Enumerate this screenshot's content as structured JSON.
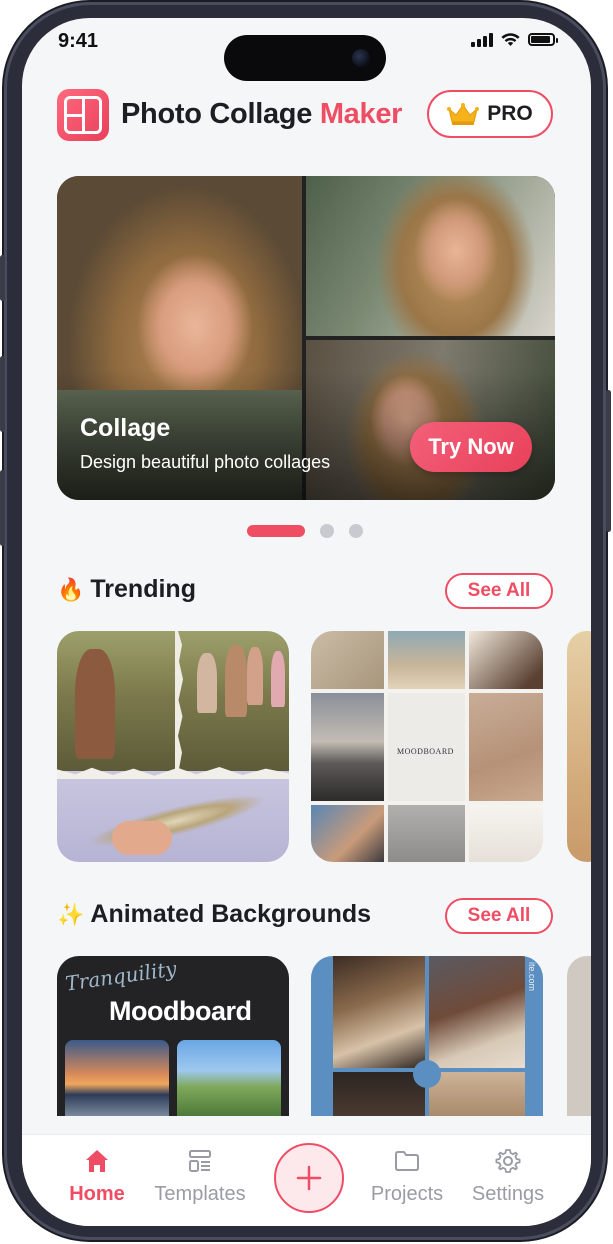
{
  "status_bar": {
    "time": "9:41"
  },
  "header": {
    "title_main": "Photo Collage ",
    "title_accent": "Maker",
    "pro_label": "PRO",
    "icon": "app-collage-icon",
    "pro_icon": "crown-icon"
  },
  "hero": {
    "title": "Collage",
    "subtitle": "Design beautiful photo collages",
    "cta": "Try Now",
    "carousel_pages": 3,
    "active_page": 1
  },
  "trending": {
    "emoji": "🔥",
    "title": "Trending",
    "see_all": "See All",
    "moodboard_label": "MOODBOARD"
  },
  "animated": {
    "emoji": "✨",
    "title": "Animated Backgrounds",
    "see_all": "See All",
    "card1_script": "Tranquility",
    "card1_title": "Moodboard",
    "card2_side_text": "ite.com"
  },
  "bottom_nav": {
    "items": [
      {
        "label": "Home",
        "icon": "home-icon",
        "active": true
      },
      {
        "label": "Templates",
        "icon": "templates-icon",
        "active": false
      },
      {
        "label": "Projects",
        "icon": "folder-icon",
        "active": false
      },
      {
        "label": "Settings",
        "icon": "gear-icon",
        "active": false
      }
    ],
    "fab_icon": "plus-icon"
  },
  "colors": {
    "accent": "#ee4d64",
    "background": "#f5f6f8",
    "text": "#1d1d22",
    "inactive": "#9a9ba5"
  }
}
